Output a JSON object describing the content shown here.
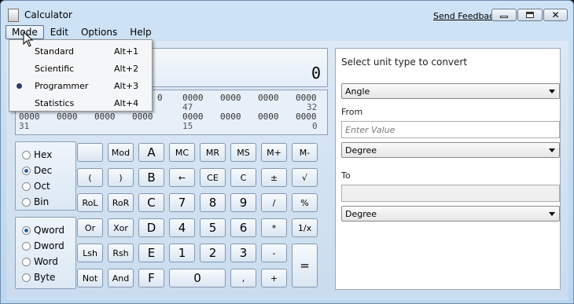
{
  "window": {
    "title": "Calculator",
    "send_feedback": "Send Feedback"
  },
  "menubar": [
    "Mode",
    "Edit",
    "Options",
    "Help"
  ],
  "mode_menu": [
    {
      "label": "Standard",
      "accel": "Alt+1",
      "checked": false
    },
    {
      "label": "Scientific",
      "accel": "Alt+2",
      "checked": false
    },
    {
      "label": "Programmer",
      "accel": "Alt+3",
      "checked": true
    },
    {
      "label": "Statistics",
      "accel": "Alt+4",
      "checked": false
    }
  ],
  "display": {
    "value": "0"
  },
  "bits": {
    "row1": [
      "0000",
      "0000",
      "0000",
      "0000"
    ],
    "row1_partial": "0",
    "row1_idx": [
      "47",
      "32"
    ],
    "row2": [
      "0000",
      "0000",
      "0000",
      "0000",
      "0000",
      "0000",
      "0000",
      "0000"
    ],
    "row2_idx": [
      "31",
      "15",
      "0"
    ]
  },
  "base_radios": [
    {
      "label": "Hex",
      "checked": false
    },
    {
      "label": "Dec",
      "checked": true
    },
    {
      "label": "Oct",
      "checked": false
    },
    {
      "label": "Bin",
      "checked": false
    }
  ],
  "word_radios": [
    {
      "label": "Qword",
      "checked": true
    },
    {
      "label": "Dword",
      "checked": false
    },
    {
      "label": "Word",
      "checked": false
    },
    {
      "label": "Byte",
      "checked": false
    }
  ],
  "keys": [
    [
      "",
      "Mod",
      "A",
      "MC",
      "MR",
      "MS",
      "M+",
      "M-"
    ],
    [
      "(",
      ")",
      "B",
      "←",
      "CE",
      "C",
      "±",
      "√"
    ],
    [
      "RoL",
      "RoR",
      "C",
      "7",
      "8",
      "9",
      "/",
      "%"
    ],
    [
      "Or",
      "Xor",
      "D",
      "4",
      "5",
      "6",
      "*",
      "1/x"
    ],
    [
      "Lsh",
      "Rsh",
      "E",
      "1",
      "2",
      "3",
      "-",
      "="
    ],
    [
      "Not",
      "And",
      "F",
      "0",
      ",",
      "+"
    ]
  ],
  "converter": {
    "heading": "Select unit type to convert",
    "unit_type": "Angle",
    "from_label": "From",
    "from_placeholder": "Enter Value",
    "from_unit": "Degree",
    "to_label": "To",
    "to_value": "",
    "to_unit": "Degree"
  }
}
